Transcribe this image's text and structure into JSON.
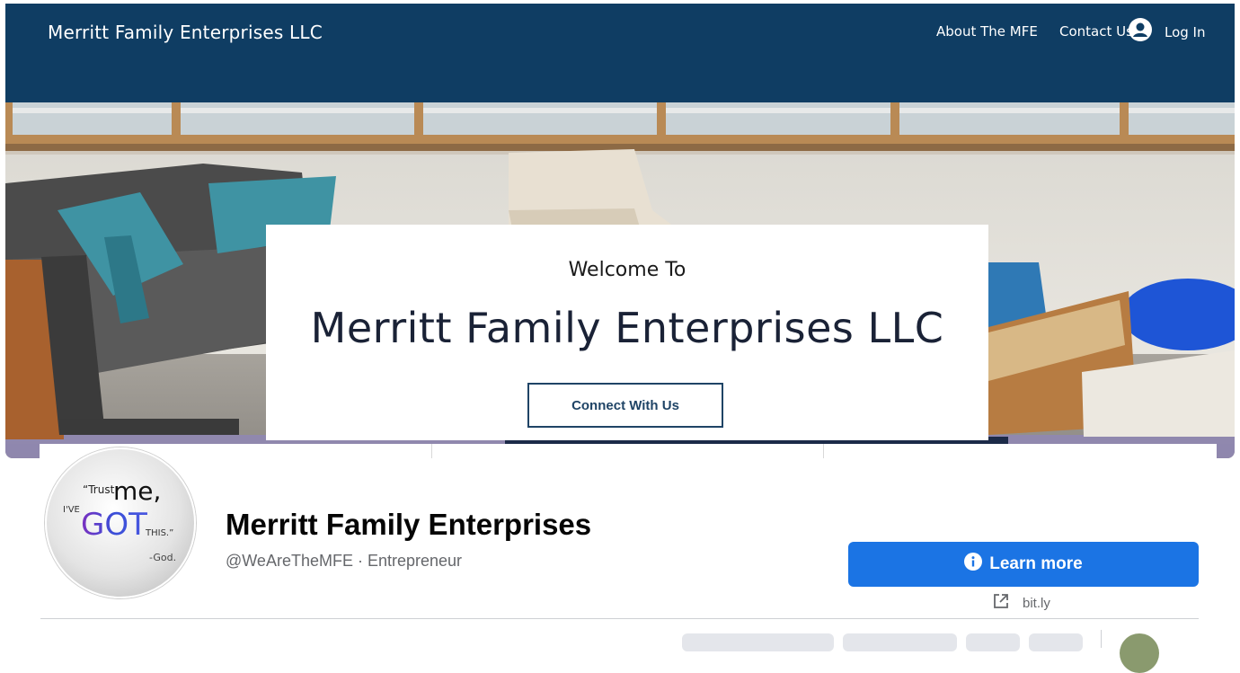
{
  "site": {
    "title": "Merritt Family Enterprises LLC",
    "nav": {
      "about": "About The MFE",
      "contact": "Contact Us",
      "login": "Log In"
    },
    "hero": {
      "welcome": "Welcome To",
      "title": "Merritt Family Enterprises LLC",
      "button": "Connect With Us"
    }
  },
  "avatar": {
    "trust": "“Trust",
    "me": "me,",
    "ive": "I'VE",
    "got": "GOT",
    "this": "THIS.”",
    "god": "-God."
  },
  "profile": {
    "name": "Merritt Family Enterprises",
    "meta": "@WeAreTheMFE · Entrepreneur"
  },
  "cta": {
    "label": "Learn more",
    "link": "bit.ly"
  },
  "colors": {
    "header": "#0f3d63",
    "cta": "#1b74e4",
    "meta": "#65676b"
  },
  "icons": {
    "account": "user-circle-icon",
    "info": "info-icon",
    "external": "external-link-icon"
  }
}
